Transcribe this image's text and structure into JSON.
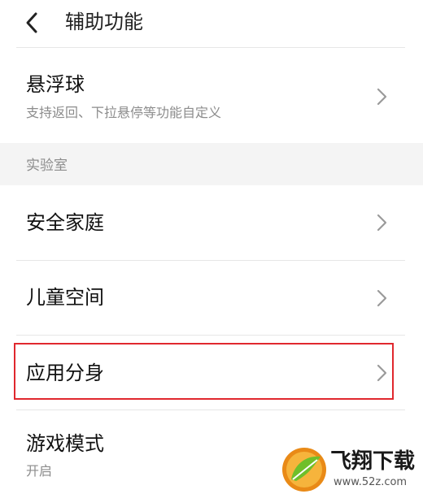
{
  "header": {
    "title": "辅助功能",
    "back_icon": "chevron-left-icon"
  },
  "floating_ball": {
    "title": "悬浮球",
    "subtitle": "支持返回、下拉悬停等功能自定义"
  },
  "section": {
    "label": "实验室"
  },
  "items": [
    {
      "title": "安全家庭"
    },
    {
      "title": "儿童空间"
    },
    {
      "title": "应用分身"
    },
    {
      "title": "游戏模式",
      "subtitle": "开启"
    }
  ],
  "colors": {
    "highlight": "#e0282e",
    "section_bg": "#f4f4f4",
    "subtitle": "#8c8c8c"
  },
  "watermark": {
    "name": "飞翔下载",
    "url": "www.52z.com"
  }
}
